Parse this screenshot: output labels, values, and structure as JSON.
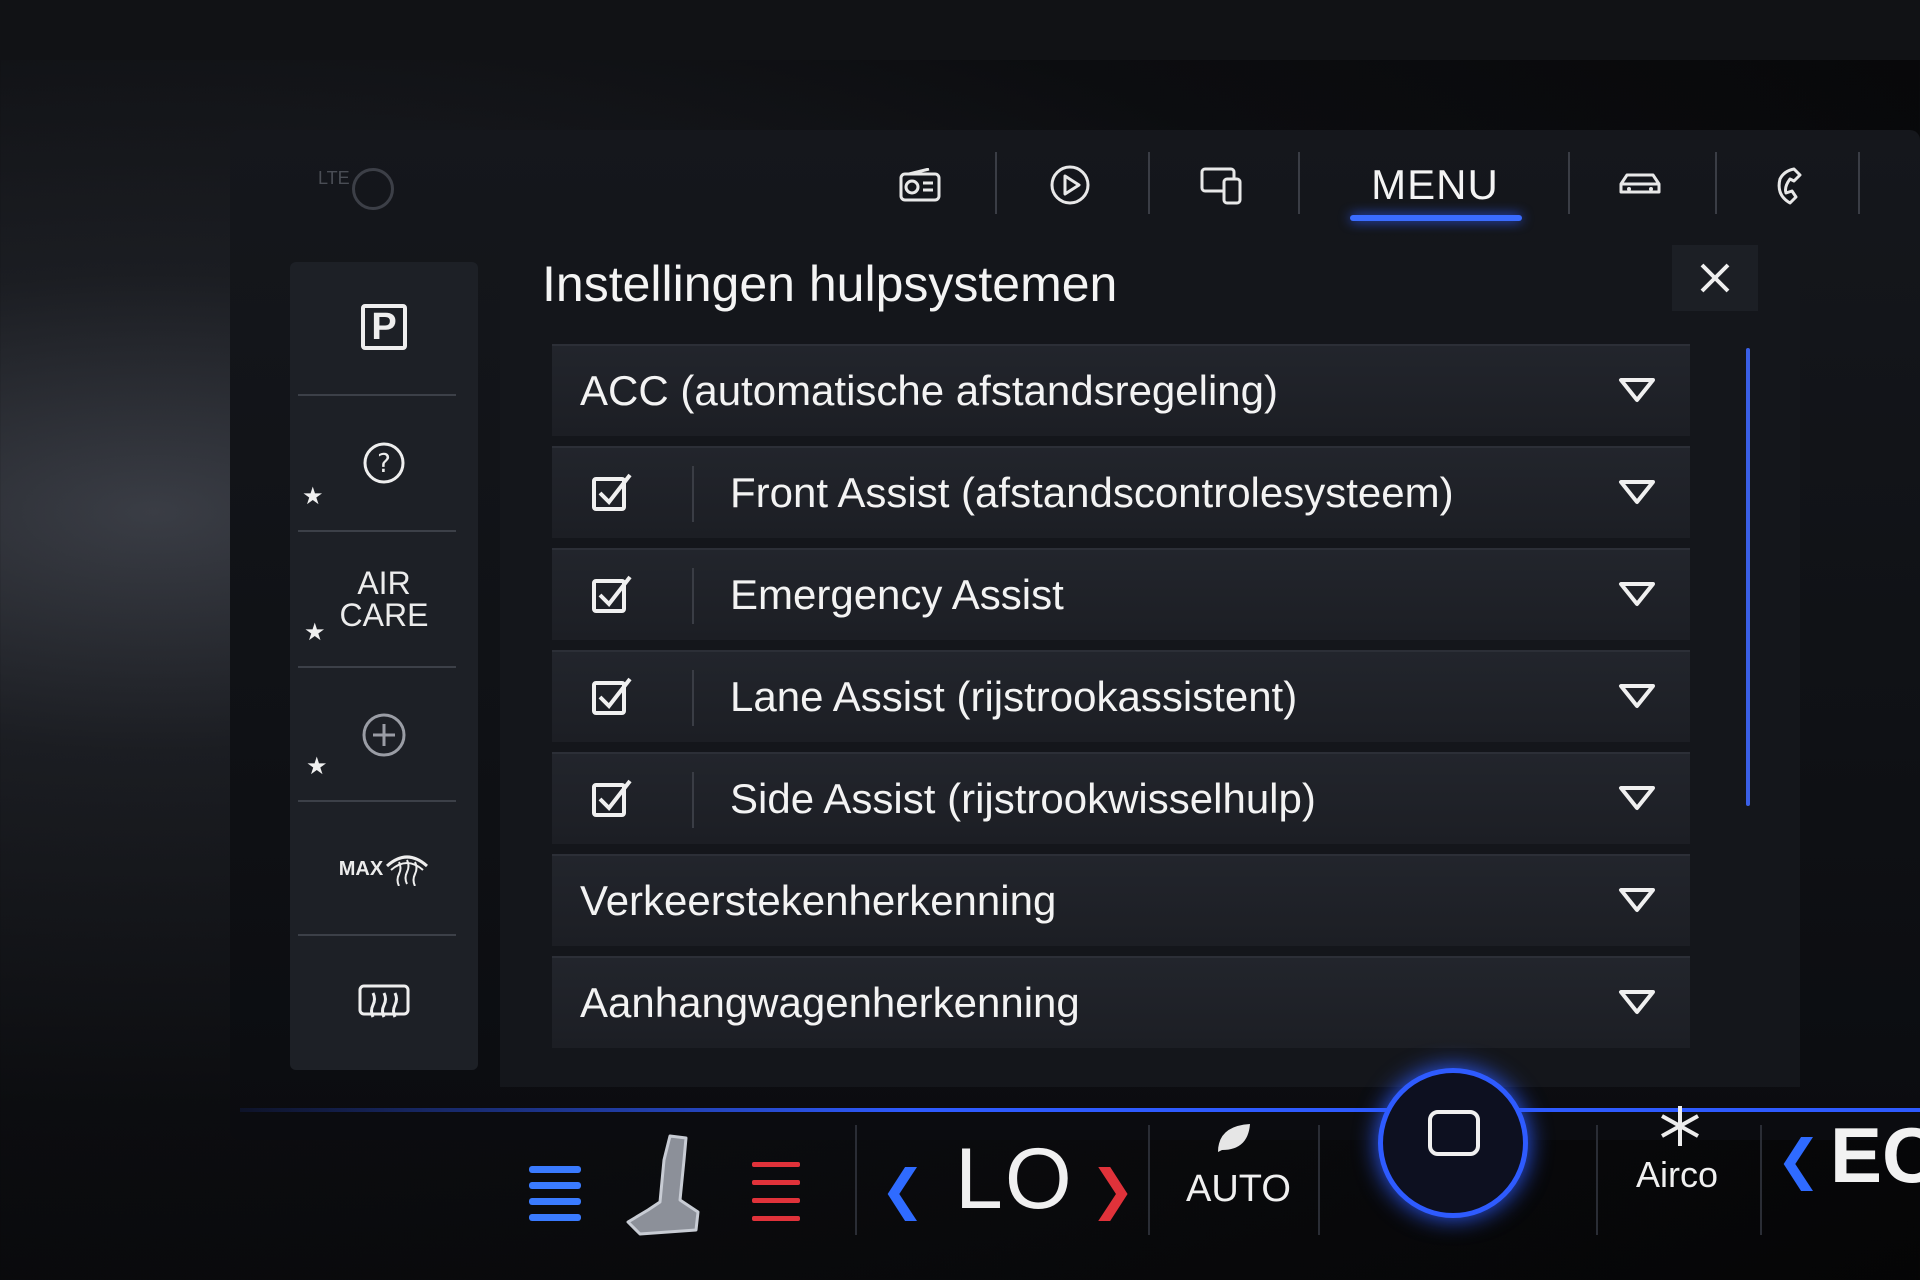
{
  "topnav": {
    "status_lte": "LTE",
    "menu_label": "MENU",
    "items": [
      {
        "icon": "radio-icon"
      },
      {
        "icon": "media-play-icon"
      },
      {
        "icon": "phone-mirror-icon"
      },
      {
        "icon": "menu"
      },
      {
        "icon": "car-icon"
      },
      {
        "icon": "phone-icon"
      }
    ]
  },
  "sidebar": {
    "items": [
      {
        "icon": "parking-icon",
        "label": "P",
        "favorite": false
      },
      {
        "icon": "help-icon",
        "favorite": true
      },
      {
        "label_line1": "AIR",
        "label_line2": "CARE",
        "favorite": true
      },
      {
        "icon": "add-icon",
        "favorite": true
      },
      {
        "icon": "max-defrost-icon",
        "label": "MAX",
        "favorite": false
      },
      {
        "icon": "rear-defrost-icon",
        "favorite": false
      }
    ]
  },
  "panel": {
    "title": "Instellingen hulpsystemen",
    "rows": [
      {
        "label": "ACC (automatische afstandsregeling)",
        "checkbox": false
      },
      {
        "label": "Front Assist (afstandscontrolesysteem)",
        "checkbox": true,
        "checked": true
      },
      {
        "label": "Emergency Assist",
        "checkbox": true,
        "checked": true
      },
      {
        "label": "Lane Assist (rijstrookassistent)",
        "checkbox": true,
        "checked": true
      },
      {
        "label": "Side Assist (rijstrookwisselhulp)",
        "checkbox": true,
        "checked": true
      },
      {
        "label": "Verkeerstekenherkenning",
        "checkbox": false
      },
      {
        "label": "Aanhangwagenherkenning",
        "checkbox": false
      }
    ]
  },
  "climate": {
    "temperature": "LO",
    "auto_label": "AUTO",
    "airco_label": "Airco",
    "eco_label": "EC"
  },
  "colors": {
    "accent": "#2e5bff",
    "heat_red": "#e0323a"
  }
}
